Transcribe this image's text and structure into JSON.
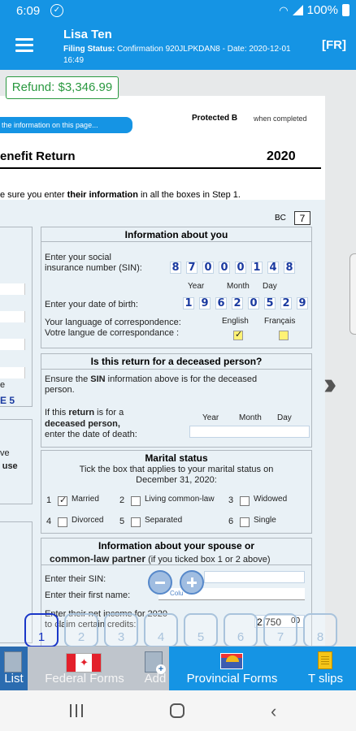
{
  "status_bar": {
    "time": "6:09",
    "battery": "100%"
  },
  "header": {
    "name": "Lisa Ten",
    "filing_status_label": "Filing Status:",
    "filing_status_value": "Confirmation 920JLPKDAN8 - Date: 2020-12-01 16:49",
    "language_button": "[FR]"
  },
  "refund": "Refund: $3,346.99",
  "form": {
    "info_pill": "the information on this page...",
    "protected": "Protected B",
    "when_completed": "when completed",
    "title": "enefit Return",
    "year": "2020",
    "ensure_prefix": "e sure you enter ",
    "ensure_bold": "their information",
    "ensure_suffix": " in all the boxes in Step 1.",
    "province_code": "BC",
    "province_box": "7"
  },
  "info_about_you": {
    "heading": "Information about you",
    "sin_label_1": "Enter your social",
    "sin_label_2": "insurance number (SIN):",
    "sin_digits": [
      "8",
      "7",
      "0",
      "0",
      "0",
      "1",
      "4",
      "8"
    ],
    "year_label": "Year",
    "month_label": "Month",
    "day_label": "Day",
    "dob_label": "Enter your date of birth:",
    "dob_digits": [
      "1",
      "9",
      "6",
      "2",
      "0",
      "5",
      "2",
      "9"
    ],
    "lang_label_en": "Your language of correspondence:",
    "lang_label_fr": "Votre langue de correspondance :",
    "english": "English",
    "francais": "Français"
  },
  "deceased": {
    "heading": "Is this return for a deceased person?",
    "text_1_prefix": "Ensure the ",
    "text_1_bold": "SIN",
    "text_1_suffix": " information above is for the deceased",
    "text_2": "person.",
    "if_prefix": "If this ",
    "if_bold": "return",
    "if_suffix": " is for a",
    "deceased_bold": "deceased person,",
    "enter_date": "enter the date of death:",
    "year": "Year",
    "month": "Month",
    "day": "Day"
  },
  "marital": {
    "heading": "Marital status",
    "sub_1": "Tick the box that applies to your marital status on",
    "sub_2": "December 31, 2020:",
    "options": [
      {
        "num": "1",
        "label": "Married"
      },
      {
        "num": "2",
        "label": "Living common-law"
      },
      {
        "num": "3",
        "label": "Widowed"
      },
      {
        "num": "4",
        "label": "Divorced"
      },
      {
        "num": "5",
        "label": "Separated"
      },
      {
        "num": "6",
        "label": "Single"
      }
    ]
  },
  "spouse": {
    "heading_1": "Information about your spouse or",
    "heading_2": "common-law partner",
    "heading_note": "(if you ticked box 1 or 2 above)",
    "sin_label": "Enter their SIN:",
    "first_name_label": "Enter their first name:",
    "net_income_1": "Enter their net income for 2020",
    "net_income_2": "to claim certain credits:",
    "net_income_value": "2,750",
    "net_income_cents": "00",
    "zoom_caption": "Colu"
  },
  "left_fragments": {
    "code": "E 5",
    "e_letter": "e",
    "ve": "ve",
    "f_use": "f use"
  },
  "pager": [
    "1",
    "2",
    "3",
    "4",
    "5",
    "6",
    "7",
    "8"
  ],
  "tabs": {
    "list": "List",
    "federal": "Federal Forms",
    "add": "Add",
    "provincial": "Provincial Forms",
    "tslips": "T slips"
  }
}
